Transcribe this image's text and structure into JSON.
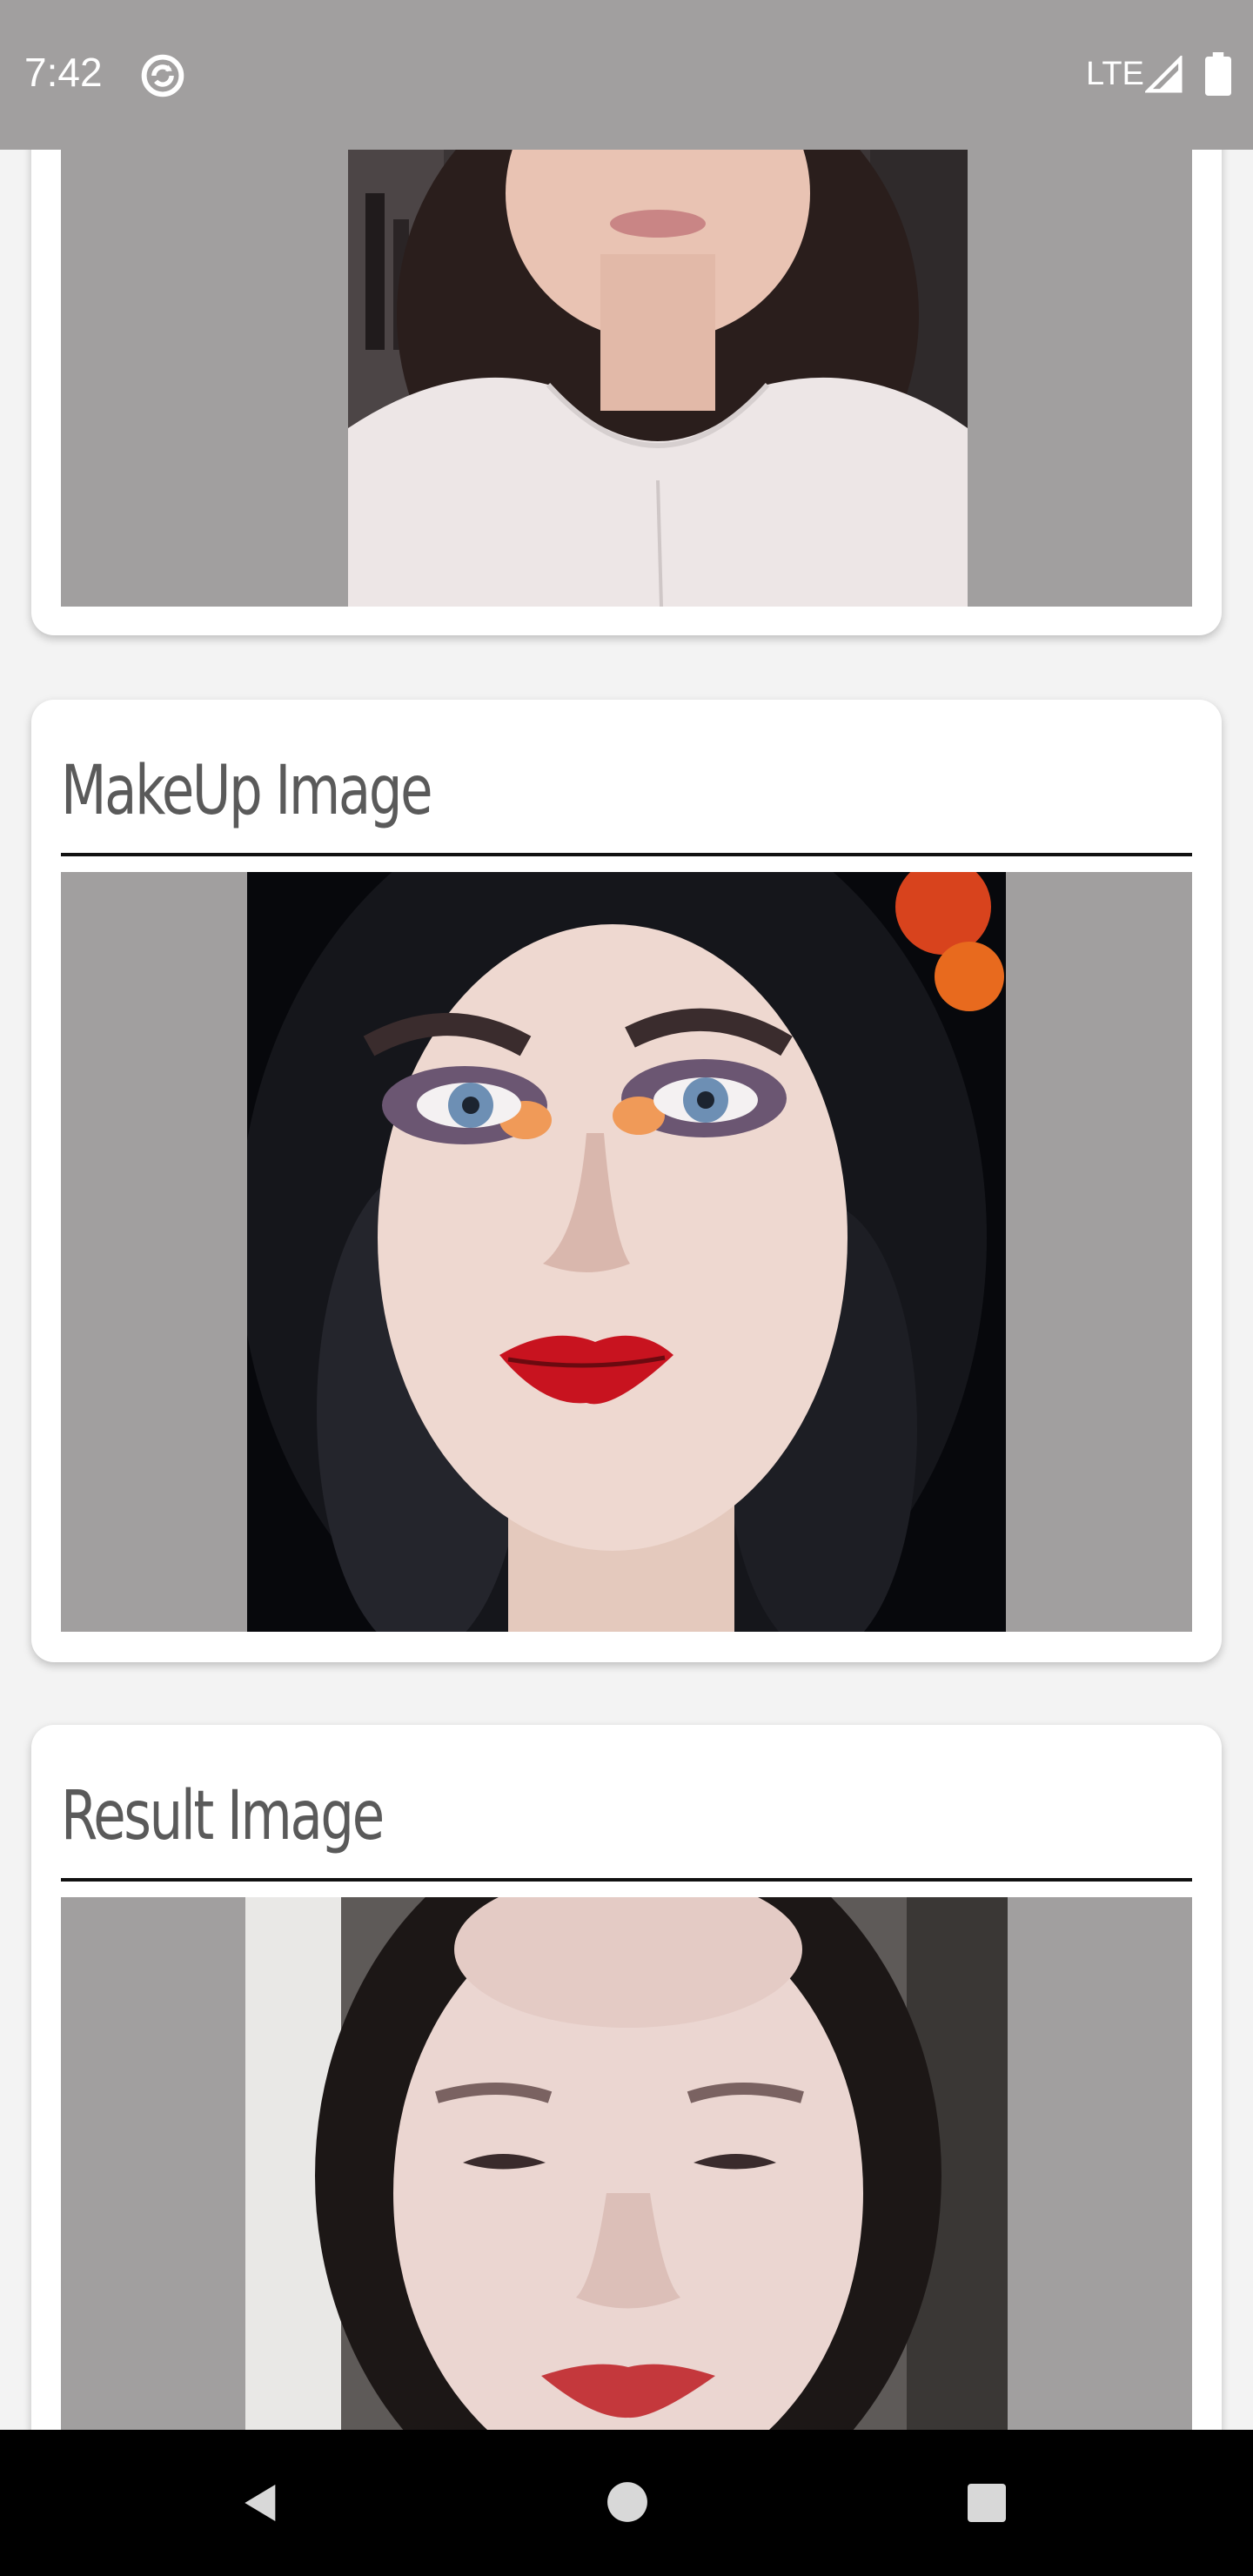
{
  "status_bar": {
    "time": "7:42",
    "network": "LTE",
    "icons": [
      "sync-icon",
      "signal-icon",
      "battery-icon"
    ]
  },
  "cards": {
    "source": {
      "image_description": "woman in white sweater (cropped at top)"
    },
    "makeup": {
      "title": "MakeUp Image",
      "image_description": "woman with dark curly hair, red lips and smoky eye makeup"
    },
    "result": {
      "title": "Result Image",
      "image_description": "result face with transferred makeup"
    }
  },
  "nav_bar": {
    "icons": [
      "back-icon",
      "home-icon",
      "recents-icon"
    ]
  },
  "colors": {
    "status_bar": "#a19f9f",
    "image_background": "#a19f9f",
    "card": "#ffffff",
    "page": "#f3f3f3",
    "title_text": "#5a5a5a",
    "nav_bar": "#000000"
  }
}
